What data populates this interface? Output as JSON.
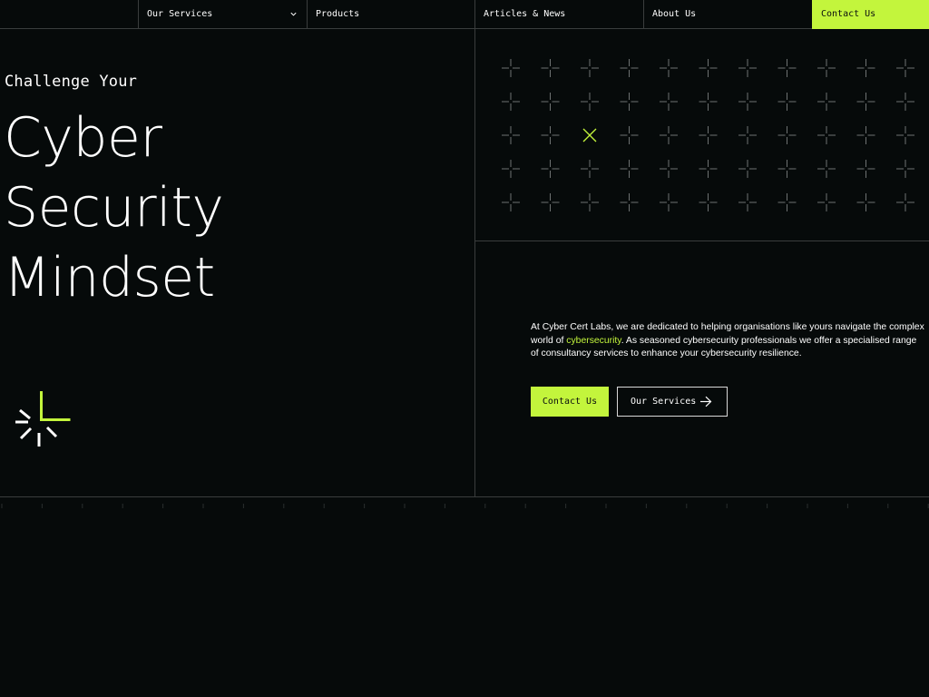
{
  "nav": {
    "items": [
      {
        "label": "Our Services",
        "has_dropdown": true
      },
      {
        "label": "Products"
      },
      {
        "label": "Articles & News"
      },
      {
        "label": "About Us"
      }
    ],
    "contact_label": "Contact Us"
  },
  "hero": {
    "eyebrow": "Challenge Your",
    "headline_lines": [
      "Cyber",
      "Security",
      "Mindset"
    ]
  },
  "intro": {
    "text_before": "At Cyber Cert Labs, we are dedicated to helping organisations like yours navigate the complex world of ",
    "highlight": "cybersecurity",
    "text_after": ". As seasoned cybersecurity professionals we offer a specialised range of consultancy services to enhance your cybersecurity resilience."
  },
  "buttons": {
    "primary_label": "Contact Us",
    "secondary_label": "Our Services"
  },
  "icons": {
    "nav_dropdown": "chevron-down-icon",
    "secondary_button": "arrow-right-icon",
    "brand": "cyber-cert-labs-logo-mark",
    "grid_cell": "crosshair-icon",
    "grid_highlight": "x-mark-icon"
  },
  "colors": {
    "background": "#060a0a",
    "accent": "#c3f53c",
    "divider": "#3a3d3d",
    "grid_mark": "#6e7272"
  }
}
